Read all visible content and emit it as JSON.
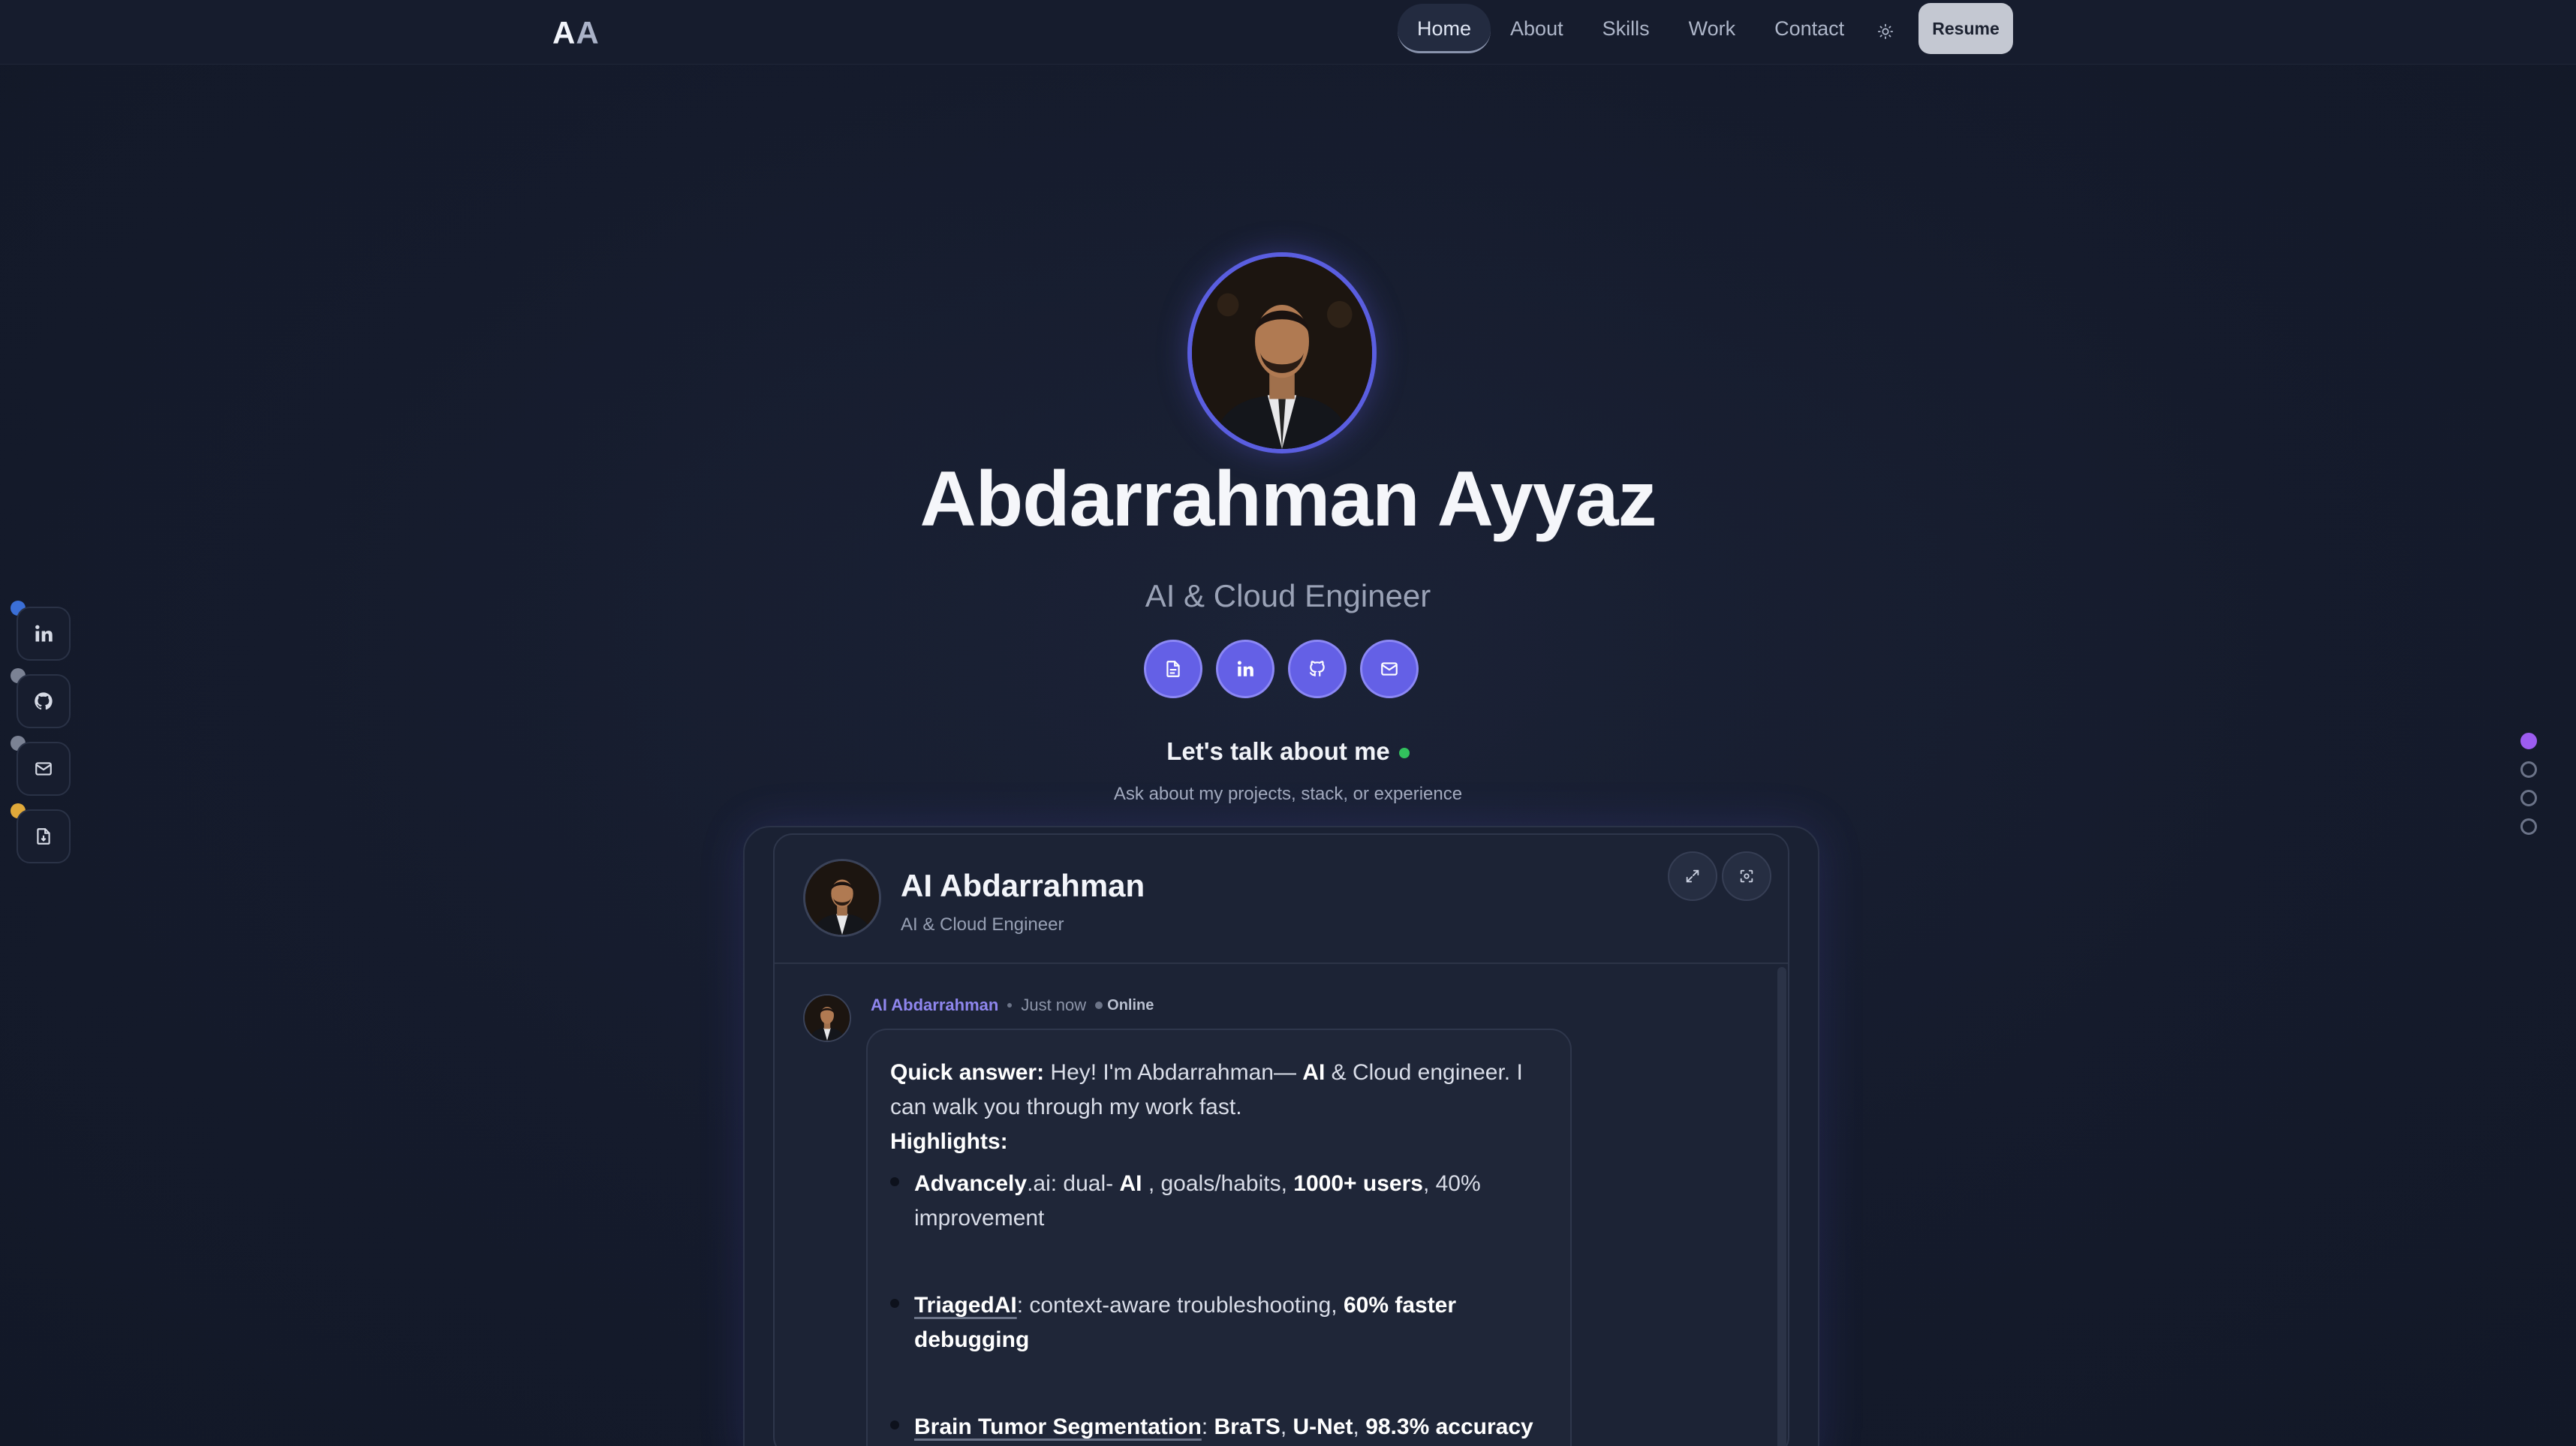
{
  "header": {
    "logo_a": "A",
    "logo_b": "A",
    "nav": [
      "Home",
      "About",
      "Skills",
      "Work",
      "Contact"
    ],
    "resume_label": "Resume"
  },
  "rail": {
    "icons": [
      "linkedin-icon",
      "github-icon",
      "mail-icon",
      "file-icon"
    ],
    "dot_colors": [
      "#3b6fd6",
      "#7b8294",
      "#7b8294",
      "#e0a93a"
    ]
  },
  "pager": {
    "count": 4,
    "active_index": 0
  },
  "hero": {
    "name": "Abdarrahman Ayyaz",
    "role": "AI & Cloud Engineer",
    "icons": [
      "document-icon",
      "linkedin-icon",
      "github-icon",
      "mail-icon"
    ],
    "talk_title": "Let's talk about me",
    "talk_sub": "Ask about my projects, stack, or experience"
  },
  "chat": {
    "title": "AI Abdarrahman",
    "subtitle": "AI & Cloud Engineer",
    "message": {
      "author": "AI Abdarrahman",
      "time": "Just now",
      "status": "Online",
      "quick_label": "Quick answer:",
      "quick_text_1": " Hey! I'm Abdarrahman— ",
      "quick_ai": "AI",
      "quick_text_2": " & Cloud engineer. I can walk you through my work fast.",
      "highlights_label": "Highlights:",
      "items": [
        {
          "name_bold": "Advancely",
          "name_rest": ".ai",
          "t1": ": dual- ",
          "b1": "AI",
          "t2": " , goals/habits, ",
          "b2": "1000+ users",
          "t3": ", 40% improvement"
        },
        {
          "name_bold": "TriagedAI",
          "t1": ": context-aware troubleshooting, ",
          "b1": "60% faster debugging"
        },
        {
          "name_bold": "Brain Tumor Segmentation",
          "t1": ": ",
          "b1": "BraTS",
          "t2": ", ",
          "b2": "U-Net",
          "t3": ", ",
          "b3": "98.3% accuracy"
        }
      ]
    }
  },
  "colors": {
    "accent": "#6460e6",
    "online": "#32c15d",
    "pager_active": "#9c5cf0"
  }
}
